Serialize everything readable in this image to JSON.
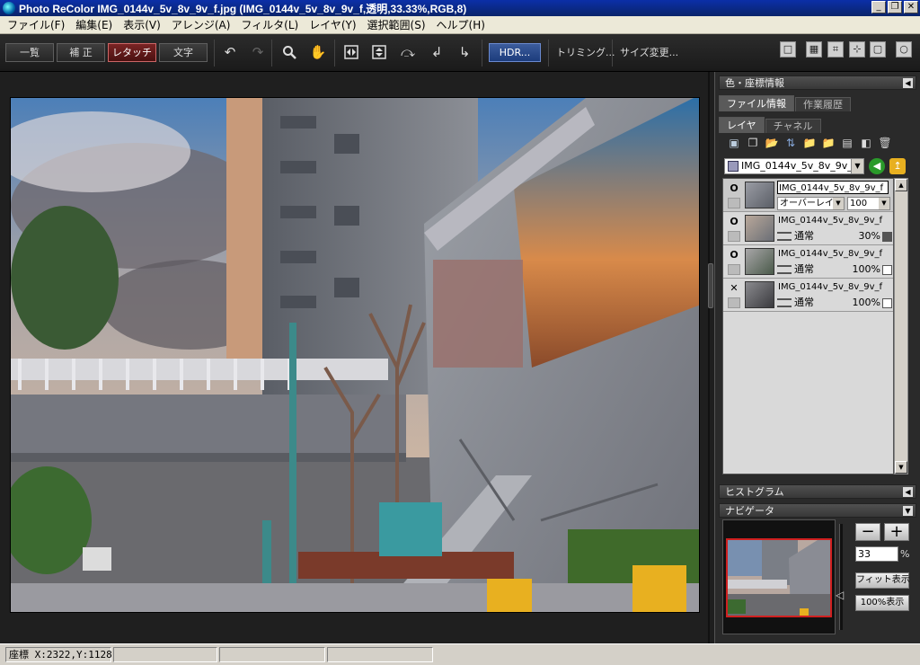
{
  "window": {
    "title": "Photo ReColor IMG_0144v_5v_8v_9v_f.jpg (IMG_0144v_5v_8v_9v_f,透明,33.33%,RGB,8)",
    "controls": [
      "_",
      "❐",
      "✕"
    ]
  },
  "menu": [
    "ファイル(F)",
    "編集(E)",
    "表示(V)",
    "アレンジ(A)",
    "フィルタ(L)",
    "レイヤ(Y)",
    "選択範囲(S)",
    "ヘルプ(H)"
  ],
  "toolbar": {
    "mode_buttons": [
      "一覧",
      "補 正",
      "レタッチ",
      "文字"
    ],
    "active_mode": "レタッチ",
    "hdr_label": "HDR...",
    "trim_label": "トリミング...",
    "resize_label": "サイズ変更...",
    "icons": [
      "undo-icon",
      "redo-icon",
      "zoom-icon",
      "hand-icon",
      "flip-horizontal-icon",
      "flip-vertical-icon",
      "rotate-cw-icon",
      "rotate-ccw-icon",
      "rotate-free-icon"
    ]
  },
  "panels": {
    "color_info": "色・座標情報",
    "file_info_tab": "ファイル情報",
    "history_tab": "作業履歴",
    "layer_tab": "レイヤ",
    "channel_tab": "チャネル",
    "histogram": "ヒストグラム",
    "navigator": "ナビゲータ"
  },
  "layer_panel": {
    "selected_layer": "IMG_0144v_5v_8v_9v_f",
    "layers": [
      {
        "name": "IMG_0144v_5v_8v_9v_f",
        "visibility": "O",
        "blend": "オーバーレイ",
        "opacity": "100",
        "editing": true
      },
      {
        "name": "IMG_0144v_5v_8v_9v_f",
        "visibility": "O",
        "blend": "通常",
        "opacity": "30%",
        "editing": false
      },
      {
        "name": "IMG_0144v_5v_8v_9v_f",
        "visibility": "O",
        "blend": "通常",
        "opacity": "100%",
        "editing": false
      },
      {
        "name": "IMG_0144v_5v_8v_9v_f",
        "visibility": "✕",
        "blend": "通常",
        "opacity": "100%",
        "editing": false
      }
    ]
  },
  "navigator": {
    "zoom_value": "33",
    "zoom_unit": "%",
    "fit_label": "フィット表示",
    "actual_label": "100%表示",
    "zoom_out": "−",
    "zoom_in": "+"
  },
  "status": {
    "coords": "座標 X:2322,Y:1128",
    "cells": [
      "",
      "",
      ""
    ]
  },
  "colors": {
    "accent_red": "#7a2424",
    "hdr_blue": "#3c5c9c",
    "nav_frame": "#d02020"
  }
}
